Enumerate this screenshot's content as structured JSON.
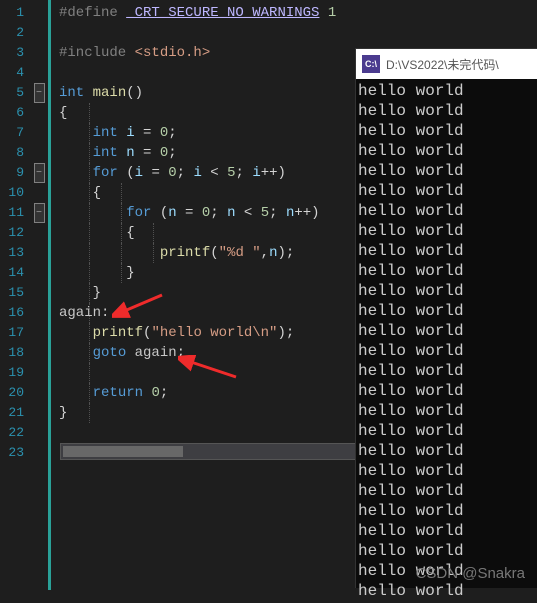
{
  "gutter": {
    "start": 1,
    "end": 23
  },
  "fold_markers": {
    "5": "-",
    "9": "-",
    "11": "-"
  },
  "code_lines": [
    [
      [
        "tok-pp",
        "#define "
      ],
      [
        "tok-mac",
        "_CRT_SECURE_NO_WARNINGS"
      ],
      [
        "tok-pp",
        " "
      ],
      [
        "tok-num",
        "1"
      ]
    ],
    [],
    [
      [
        "tok-pp",
        "#include "
      ],
      [
        "tok-inc",
        "<stdio.h>"
      ]
    ],
    [],
    [
      [
        "tok-kw",
        "int"
      ],
      [
        "tok-op",
        " "
      ],
      [
        "tok-fn",
        "main"
      ],
      [
        "tok-br",
        "()"
      ]
    ],
    [
      [
        "tok-br",
        "{"
      ]
    ],
    [
      [
        "tok-op",
        "    "
      ],
      [
        "tok-kw",
        "int"
      ],
      [
        "tok-op",
        " "
      ],
      [
        "tok-var",
        "i"
      ],
      [
        "tok-op",
        " = "
      ],
      [
        "tok-num",
        "0"
      ],
      [
        "tok-op",
        ";"
      ]
    ],
    [
      [
        "tok-op",
        "    "
      ],
      [
        "tok-kw",
        "int"
      ],
      [
        "tok-op",
        " "
      ],
      [
        "tok-var",
        "n"
      ],
      [
        "tok-op",
        " = "
      ],
      [
        "tok-num",
        "0"
      ],
      [
        "tok-op",
        ";"
      ]
    ],
    [
      [
        "tok-op",
        "    "
      ],
      [
        "tok-kw",
        "for"
      ],
      [
        "tok-op",
        " ("
      ],
      [
        "tok-var",
        "i"
      ],
      [
        "tok-op",
        " = "
      ],
      [
        "tok-num",
        "0"
      ],
      [
        "tok-op",
        "; "
      ],
      [
        "tok-var",
        "i"
      ],
      [
        "tok-op",
        " < "
      ],
      [
        "tok-num",
        "5"
      ],
      [
        "tok-op",
        "; "
      ],
      [
        "tok-var",
        "i"
      ],
      [
        "tok-op",
        "++)"
      ]
    ],
    [
      [
        "tok-op",
        "    "
      ],
      [
        "tok-br",
        "{"
      ]
    ],
    [
      [
        "tok-op",
        "        "
      ],
      [
        "tok-kw",
        "for"
      ],
      [
        "tok-op",
        " ("
      ],
      [
        "tok-var",
        "n"
      ],
      [
        "tok-op",
        " = "
      ],
      [
        "tok-num",
        "0"
      ],
      [
        "tok-op",
        "; "
      ],
      [
        "tok-var",
        "n"
      ],
      [
        "tok-op",
        " < "
      ],
      [
        "tok-num",
        "5"
      ],
      [
        "tok-op",
        "; "
      ],
      [
        "tok-var",
        "n"
      ],
      [
        "tok-op",
        "++)"
      ]
    ],
    [
      [
        "tok-op",
        "        "
      ],
      [
        "tok-br",
        "{"
      ]
    ],
    [
      [
        "tok-op",
        "            "
      ],
      [
        "tok-fn",
        "printf"
      ],
      [
        "tok-op",
        "("
      ],
      [
        "tok-str",
        "\"%d \""
      ],
      [
        "tok-op",
        ","
      ],
      [
        "tok-var",
        "n"
      ],
      [
        "tok-op",
        ");"
      ]
    ],
    [
      [
        "tok-op",
        "        "
      ],
      [
        "tok-br",
        "}"
      ]
    ],
    [
      [
        "tok-op",
        "    "
      ],
      [
        "tok-br",
        "}"
      ]
    ],
    [
      [
        "tok-lbl",
        "again:"
      ]
    ],
    [
      [
        "tok-op",
        "    "
      ],
      [
        "tok-fn",
        "printf"
      ],
      [
        "tok-op",
        "("
      ],
      [
        "tok-str",
        "\"hello world\\n\""
      ],
      [
        "tok-op",
        ");"
      ]
    ],
    [
      [
        "tok-op",
        "    "
      ],
      [
        "tok-kw",
        "goto"
      ],
      [
        "tok-op",
        " "
      ],
      [
        "tok-lbl",
        "again"
      ],
      [
        "tok-op",
        ";"
      ]
    ],
    [],
    [
      [
        "tok-op",
        "    "
      ],
      [
        "tok-kw",
        "return"
      ],
      [
        "tok-op",
        " "
      ],
      [
        "tok-num",
        "0"
      ],
      [
        "tok-op",
        ";"
      ]
    ],
    [
      [
        "tok-br",
        "}"
      ]
    ],
    [],
    []
  ],
  "indent_guides": {
    "6": [
      1
    ],
    "7": [
      1
    ],
    "8": [
      1
    ],
    "9": [
      1
    ],
    "10": [
      1,
      2
    ],
    "11": [
      1,
      2
    ],
    "12": [
      1,
      2,
      3
    ],
    "13": [
      1,
      2,
      3
    ],
    "14": [
      1,
      2
    ],
    "15": [
      1
    ],
    "16": [
      1
    ],
    "17": [
      1
    ],
    "18": [
      1
    ],
    "19": [
      1
    ],
    "20": [
      1
    ],
    "21": [
      1
    ]
  },
  "console": {
    "title": "D:\\VS2022\\未完代码\\",
    "icon_text": "C:\\",
    "output_line": "hello world",
    "output_repeat": 26
  },
  "watermark": "CSDN @Snakra"
}
